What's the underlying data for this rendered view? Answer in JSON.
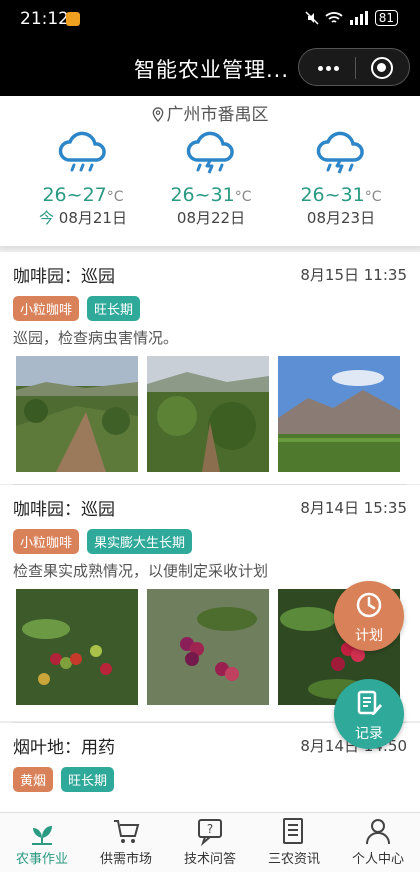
{
  "status_bar": {
    "time": "21:12",
    "battery": "81"
  },
  "title_bar": {
    "title": "智能农业管理..."
  },
  "weather": {
    "location": "广州市番禺区",
    "days": [
      {
        "temp": "26~27",
        "unit": "°C",
        "today_label": "今",
        "date": "08月21日",
        "icon": "rain-cloud-icon"
      },
      {
        "temp": "26~31",
        "unit": "°C",
        "today_label": "",
        "date": "08月22日",
        "icon": "thunderstorm-icon"
      },
      {
        "temp": "26~31",
        "unit": "°C",
        "today_label": "",
        "date": "08月23日",
        "icon": "thunderstorm-icon"
      }
    ]
  },
  "posts": [
    {
      "title": "咖啡园：巡园",
      "time": "8月15日 11:35",
      "tags": [
        "小粒咖啡",
        "旺长期"
      ],
      "desc": "巡园，检查病虫害情况。"
    },
    {
      "title": "咖啡园：巡园",
      "time": "8月14日 15:35",
      "tags": [
        "小粒咖啡",
        "果实膨大生长期"
      ],
      "desc": "检查果实成熟情况，以便制定采收计划"
    },
    {
      "title": "烟叶地：用药",
      "time": "8月14日 14:50",
      "tags": [
        "黄烟",
        "旺长期"
      ],
      "desc": ""
    }
  ],
  "fabs": {
    "plan": "计划",
    "record": "记录"
  },
  "nav": [
    "农事作业",
    "供需市场",
    "技术问答",
    "三农资讯",
    "个人中心"
  ],
  "colors": {
    "accent": "#2a9a83",
    "tag_orange": "#d9825a",
    "tag_teal": "#2fa99a"
  }
}
